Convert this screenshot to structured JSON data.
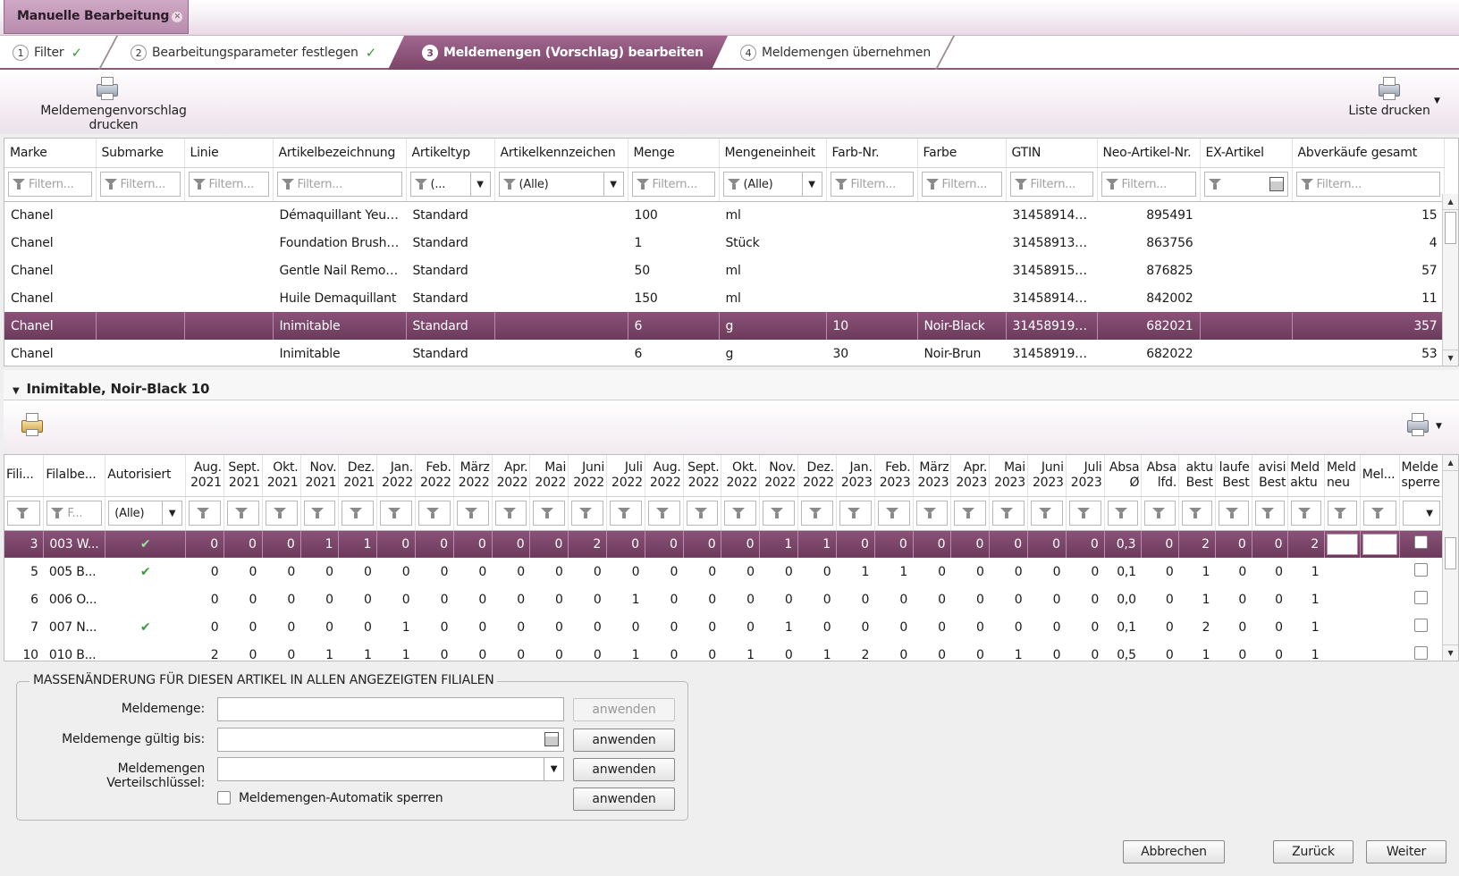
{
  "window": {
    "tab_title": "Manuelle Bearbeitung"
  },
  "wizard": {
    "steps": [
      {
        "num": "1",
        "label": "Filter",
        "done": true
      },
      {
        "num": "2",
        "label": "Bearbeitungsparameter festlegen",
        "done": true
      },
      {
        "num": "3",
        "label": "Meldemengen (Vorschlag) bearbeiten",
        "active": true
      },
      {
        "num": "4",
        "label": "Meldemengen übernehmen"
      }
    ]
  },
  "toolbar": {
    "print_proposal": "Meldemengenvorschlag drucken",
    "print_list": "Liste drucken"
  },
  "grid1": {
    "columns": [
      "Marke",
      "Submarke",
      "Linie",
      "Artikelbezeichnung",
      "Artikeltyp",
      "Artikelkennzeichen",
      "Menge",
      "Mengeneinheit",
      "Farb-Nr.",
      "Farbe",
      "GTIN",
      "Neo-Artikel-Nr.",
      "EX-Artikel",
      "Abverkäufe gesamt"
    ],
    "filter_placeholder": "Filtern...",
    "filter_alle": "(Alle)",
    "filter_ellipsis": "(...",
    "rows": [
      [
        "Chanel",
        "",
        "",
        "Démaquillant Yeux...",
        "Standard",
        "",
        "100",
        "ml",
        "",
        "",
        "314589141...",
        "895491",
        "",
        "15"
      ],
      [
        "Chanel",
        "",
        "",
        "Foundation Brush ...",
        "Standard",
        "",
        "1",
        "Stück",
        "",
        "",
        "314589138...",
        "863756",
        "",
        "4"
      ],
      [
        "Chanel",
        "",
        "",
        "Gentle Nail Remover",
        "Standard",
        "",
        "50",
        "ml",
        "",
        "",
        "314589158...",
        "876825",
        "",
        "57"
      ],
      [
        "Chanel",
        "",
        "",
        "Huile Demaquillant",
        "Standard",
        "",
        "150",
        "ml",
        "",
        "",
        "314589141...",
        "842002",
        "",
        "11"
      ],
      [
        "Chanel",
        "",
        "",
        "Inimitable",
        "Standard",
        "",
        "6",
        "g",
        "10",
        "Noir-Black",
        "314589195...",
        "682021",
        "",
        "357"
      ],
      [
        "Chanel",
        "",
        "",
        "Inimitable",
        "Standard",
        "",
        "6",
        "g",
        "30",
        "Noir-Brun",
        "314589195...",
        "682022",
        "",
        "53"
      ]
    ],
    "selected_row": 4
  },
  "detail": {
    "title": "Inimitable, Noir-Black 10"
  },
  "grid2": {
    "columns": [
      "Fili...",
      "Filalbe...",
      "Autorisiert",
      "Aug. 2021",
      "Sept. 2021",
      "Okt. 2021",
      "Nov. 2021",
      "Dez. 2021",
      "Jan. 2022",
      "Feb. 2022",
      "März 2022",
      "Apr. 2022",
      "Mai 2022",
      "Juni 2022",
      "Juli 2022",
      "Aug. 2022",
      "Sept. 2022",
      "Okt. 2022",
      "Nov. 2022",
      "Dez. 2022",
      "Jan. 2023",
      "Feb. 2023",
      "März 2023",
      "Apr. 2023",
      "Mai 2023",
      "Juni 2023",
      "Juli 2023",
      "Absa Ø",
      "Absa lfd.",
      "aktu Best",
      "laufe Best",
      "avisi Best",
      "Meld aktu",
      "Meld neu",
      "Mel...",
      "Melde sperre"
    ],
    "filter_alle": "(Alle)",
    "filter_f": "F...",
    "rows": [
      {
        "vals": [
          "3",
          "003 W...",
          "✔",
          "0",
          "0",
          "0",
          "1",
          "1",
          "0",
          "0",
          "0",
          "0",
          "0",
          "2",
          "0",
          "0",
          "0",
          "0",
          "1",
          "1",
          "0",
          "0",
          "0",
          "0",
          "0",
          "0",
          "0",
          "0,3",
          "0",
          "2",
          "0",
          "0",
          "2"
        ]
      },
      {
        "vals": [
          "5",
          "005 B...",
          "✔",
          "0",
          "0",
          "0",
          "0",
          "0",
          "0",
          "0",
          "0",
          "0",
          "0",
          "0",
          "0",
          "0",
          "0",
          "0",
          "0",
          "0",
          "1",
          "1",
          "0",
          "0",
          "0",
          "0",
          "0",
          "0,1",
          "0",
          "1",
          "0",
          "0",
          "1"
        ]
      },
      {
        "vals": [
          "6",
          "006 O...",
          "",
          "0",
          "0",
          "0",
          "0",
          "0",
          "0",
          "0",
          "0",
          "0",
          "0",
          "0",
          "1",
          "0",
          "0",
          "0",
          "0",
          "0",
          "0",
          "0",
          "0",
          "0",
          "0",
          "0",
          "0",
          "0,0",
          "0",
          "1",
          "0",
          "0",
          "1"
        ]
      },
      {
        "vals": [
          "7",
          "007 N...",
          "✔",
          "0",
          "0",
          "0",
          "0",
          "0",
          "1",
          "0",
          "0",
          "0",
          "0",
          "0",
          "0",
          "0",
          "0",
          "0",
          "1",
          "0",
          "0",
          "0",
          "0",
          "0",
          "0",
          "0",
          "0",
          "0,1",
          "0",
          "2",
          "0",
          "0",
          "1"
        ]
      },
      {
        "vals": [
          "10",
          "010 B...",
          "",
          "2",
          "0",
          "0",
          "1",
          "1",
          "1",
          "0",
          "0",
          "0",
          "0",
          "0",
          "1",
          "0",
          "0",
          "1",
          "0",
          "1",
          "2",
          "0",
          "0",
          "0",
          "1",
          "0",
          "0",
          "0,5",
          "0",
          "1",
          "0",
          "0",
          "1"
        ]
      }
    ]
  },
  "mass": {
    "legend": "MASSENÄNDERUNG FÜR DIESEN ARTIKEL IN ALLEN ANGEZEIGTEN FILIALEN",
    "label_meldemenge": "Meldemenge:",
    "label_gueltig": "Meldemenge gültig bis:",
    "label_verteil": "Meldemengen Verteilschlüssel:",
    "label_automatik": "Meldemengen-Automatik sperren",
    "apply": "anwenden"
  },
  "footer": {
    "cancel": "Abbrechen",
    "back": "Zurück",
    "next": "Weiter"
  },
  "colors": {
    "accent": "#7c4469",
    "check": "#3a9a3a"
  }
}
